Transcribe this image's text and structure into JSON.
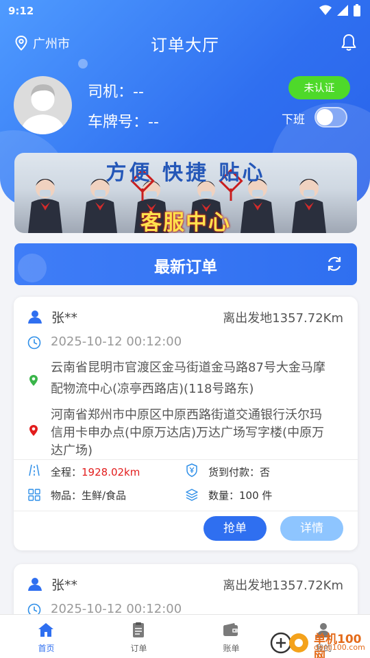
{
  "status_bar": {
    "time": "9:12"
  },
  "header": {
    "city": "广州市",
    "title": "订单大厅"
  },
  "driver": {
    "driver_label": "司机：--",
    "plate_label": "车牌号：--",
    "auth_button": "未认证",
    "offline_label": "下班",
    "online": false
  },
  "banner": {
    "slogan": "方便 快捷 贴心",
    "service": "客服中心"
  },
  "orders_header": {
    "title": "最新订单"
  },
  "orders": [
    {
      "name": "张**",
      "distance": "离出发地1357.72Km",
      "time": "2025-10-12 00:12:00",
      "from_line1": "云南省昆明市官渡区金马街道金马路87号大金马摩",
      "from_line2": "配物流中心(凉亭西路店)(118号路东)",
      "to_line1": "河南省郑州市中原区中原西路街道交通银行沃尔玛",
      "to_line2": "信用卡申办点(中原万达店)万达广场写字楼(中原万",
      "to_line3": "达广场)",
      "total_label": "全程：",
      "total_value": "1928.02km",
      "cod_label": "货到付款：否",
      "goods_label": "物品：生鲜/食品",
      "qty_label": "数量：100 件",
      "grab_button": "抢单",
      "detail_button": "详情"
    },
    {
      "name": "张**",
      "distance": "离出发地1357.72Km",
      "time": "2025-10-12 00:12:00"
    }
  ],
  "tabs": [
    {
      "label": "首页",
      "icon": "home-icon",
      "active": true
    },
    {
      "label": "订单",
      "icon": "clipboard-icon",
      "active": false
    },
    {
      "label": "账单",
      "icon": "wallet-icon",
      "active": false
    },
    {
      "label": "我的",
      "icon": "user-icon",
      "active": false
    }
  ],
  "watermark": {
    "text": "单机100网",
    "sub": "danji100.com"
  },
  "colors": {
    "primary": "#2f6ff0",
    "auth_green": "#4ed92a",
    "distance_red": "#e21d1d",
    "detail_light": "#8ec5ff"
  }
}
